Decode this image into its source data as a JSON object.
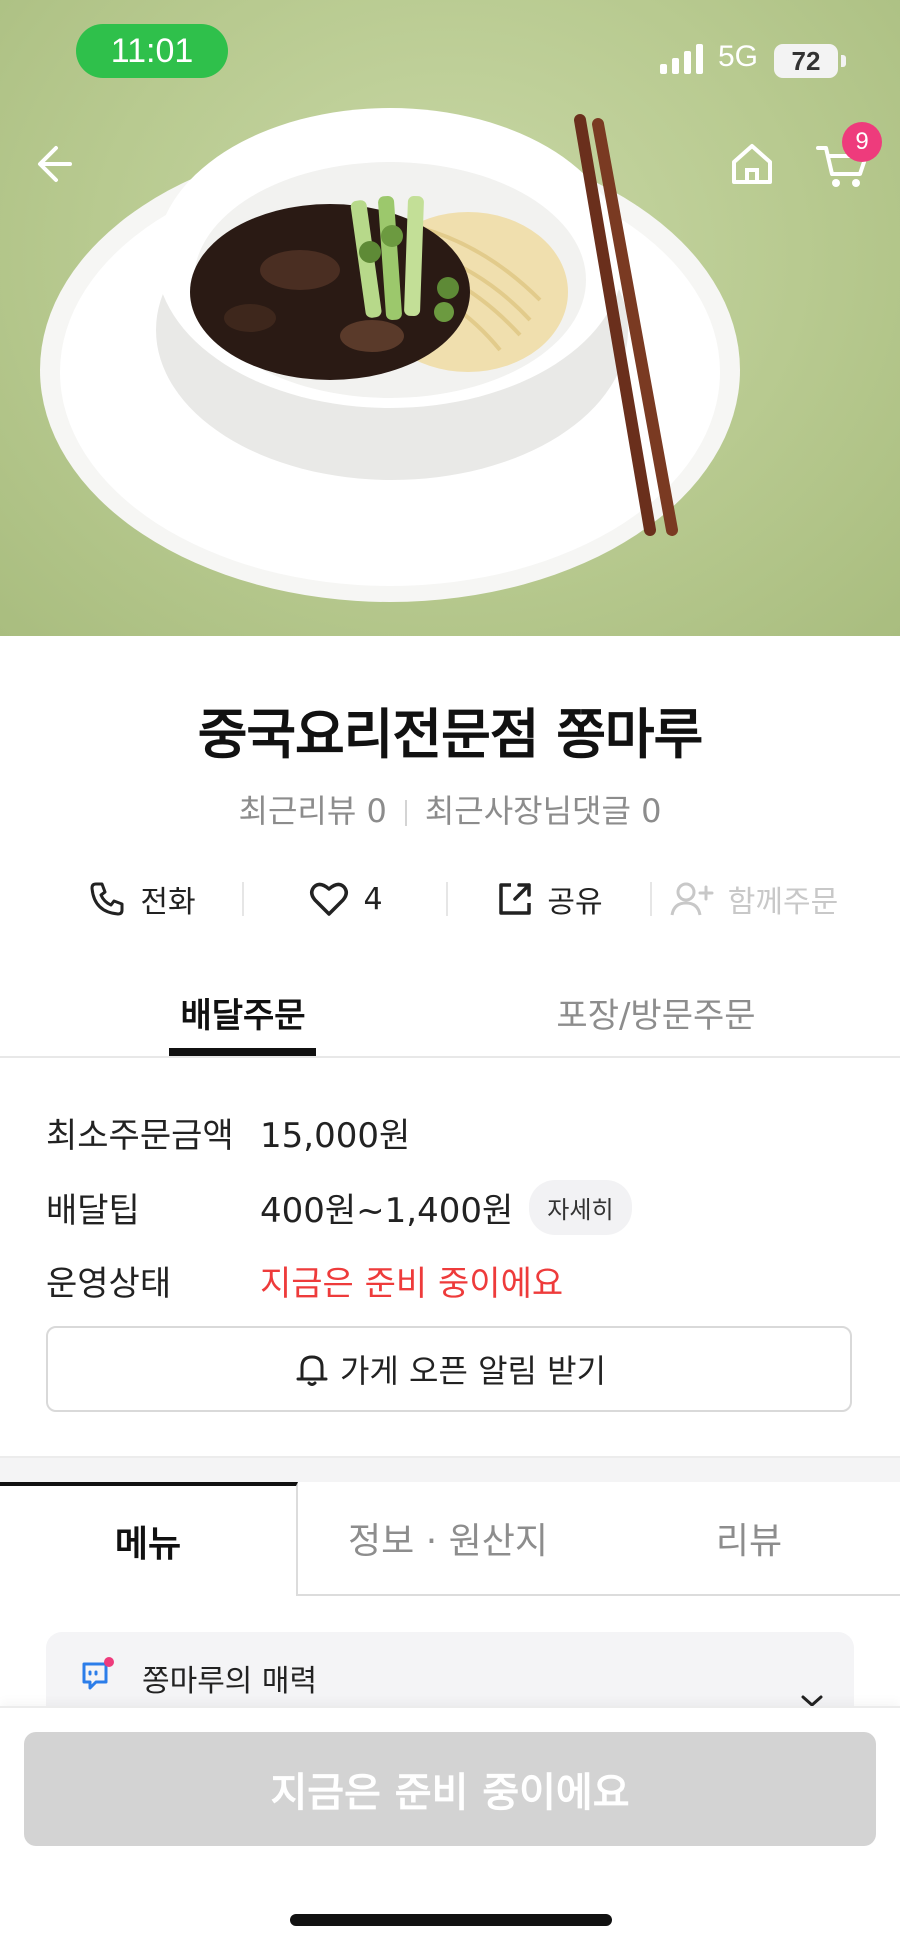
{
  "status_bar": {
    "time": "11:01",
    "network": "5G",
    "battery": "72"
  },
  "header": {
    "cart_count": "9"
  },
  "store": {
    "name": "중국요리전문점 쫑마루",
    "recent_reviews": "최근리뷰 0",
    "recent_owner_comments": "최근사장님댓글 0"
  },
  "actions": {
    "call": "전화",
    "like_count": "4",
    "share": "공유",
    "group_order": "함께주문"
  },
  "order_tabs": [
    "배달주문",
    "포장/방문주문"
  ],
  "info": {
    "min_order_label": "최소주문금액",
    "min_order_value": "15,000원",
    "delivery_tip_label": "배달팁",
    "delivery_tip_value": "400원~1,400원",
    "detail_chip": "자세히",
    "status_label": "운영상태",
    "status_value": "지금은 준비 중이에요"
  },
  "open_alert_button": "가게 오픈 알림 받기",
  "content_tabs": [
    "메뉴",
    "정보 · 원산지",
    "리뷰"
  ],
  "charm_card": {
    "label": "쫑마루의 매력"
  },
  "bottom_button": "지금은 준비 중이에요",
  "colors": {
    "status_green": "#2fc04b",
    "badge_pink": "#ee3b7c",
    "status_red": "#ee3b3b",
    "disabled_gray": "#d3d3d3"
  }
}
